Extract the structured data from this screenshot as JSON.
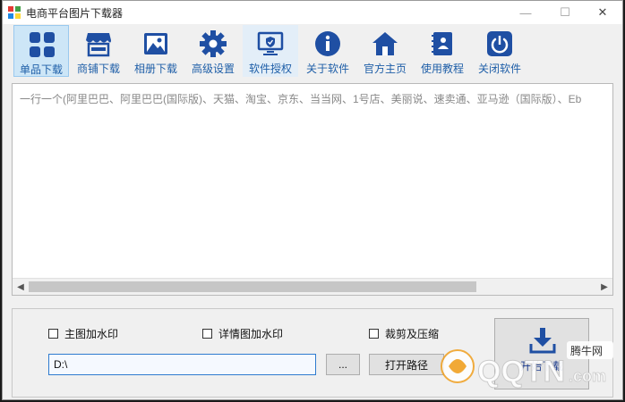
{
  "window": {
    "title": "电商平台图片下载器",
    "controls": {
      "minimize": "—",
      "maximize": "☐",
      "close": "✕"
    }
  },
  "toolbar": {
    "items": [
      {
        "label": "单品下载",
        "icon": "grid-icon",
        "active": true
      },
      {
        "label": "商铺下载",
        "icon": "store-icon"
      },
      {
        "label": "相册下载",
        "icon": "image-icon"
      },
      {
        "label": "高级设置",
        "icon": "gear-icon"
      },
      {
        "label": "软件授权",
        "icon": "monitor-shield-icon"
      },
      {
        "label": "关于软件",
        "icon": "info-icon"
      },
      {
        "label": "官方主页",
        "icon": "home-icon"
      },
      {
        "label": "使用教程",
        "icon": "book-icon"
      },
      {
        "label": "关闭软件",
        "icon": "power-icon"
      }
    ]
  },
  "url_area": {
    "placeholder": "一行一个(阿里巴巴、阿里巴巴(国际版)、天猫、淘宝、京东、当当网、1号店、美丽说、速卖通、亚马逊（国际版）、Eb"
  },
  "options": {
    "main_watermark": "主图加水印",
    "detail_watermark": "详情图加水印",
    "crop_compress": "裁剪及压缩"
  },
  "path": {
    "value": "D:\\",
    "browse_label": "...",
    "open_label": "打开路径"
  },
  "start": {
    "label": "开始下载"
  },
  "watermark": {
    "brand": "腾牛网",
    "domain": "QQTN.com"
  },
  "colors": {
    "accent": "#1f4fa3",
    "active_bg": "#cde6f7",
    "label": "#1f5fa8"
  }
}
